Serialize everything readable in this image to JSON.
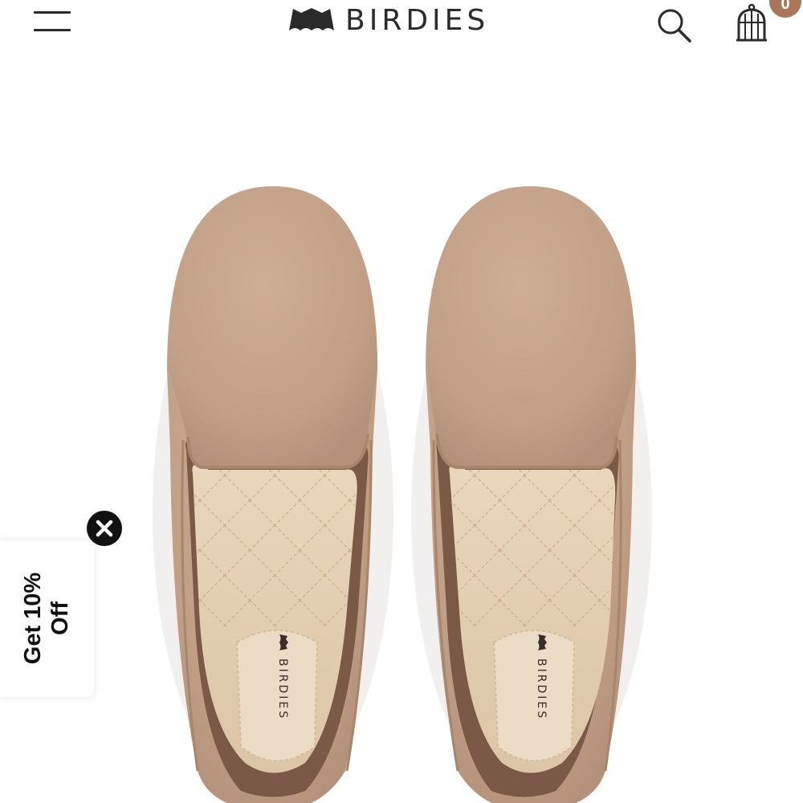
{
  "header": {
    "menu_icon": "hamburger-menu-icon",
    "brand_name": "BIRDIES",
    "search_icon": "search-icon",
    "cart_icon": "birdcage-cart-icon",
    "cart_count": "0"
  },
  "product": {
    "image_alt": "Top view of a pair of taupe suede loafers with quilted satin insoles",
    "insole_brand": "BIRDIES",
    "colors": {
      "suede": "#c5a48c",
      "insole": "#e8d5bd",
      "piping": "#a8866c"
    }
  },
  "promo": {
    "line1": "Get 10%",
    "line2": "Off",
    "close_icon": "close-icon"
  },
  "colors": {
    "text": "#2b2b2b",
    "cart_badge": "#a8775a",
    "background": "#ffffff"
  }
}
